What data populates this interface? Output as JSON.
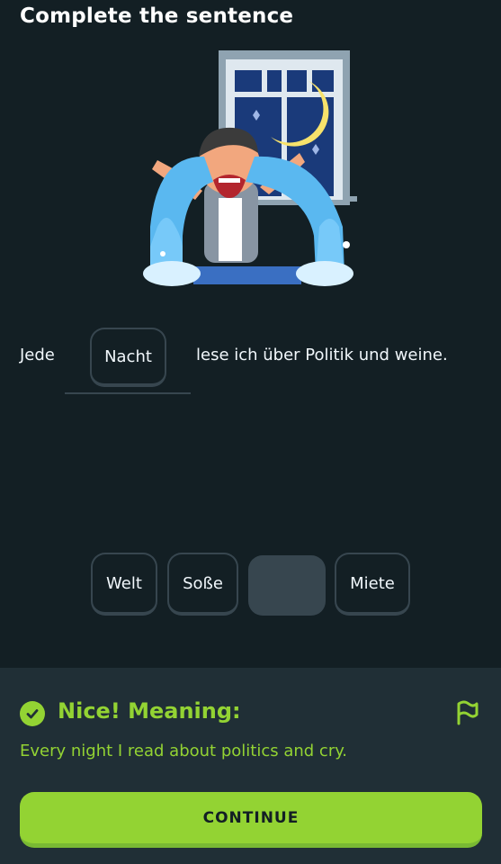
{
  "header": {
    "title": "Complete the sentence"
  },
  "sentence": {
    "before": "Jede",
    "answer": "Nacht",
    "after": "lese ich über Politik und weine."
  },
  "word_bank": {
    "options": [
      "Welt",
      "Soße",
      "",
      "Miete"
    ]
  },
  "feedback": {
    "heading": "Nice! Meaning:",
    "meaning": "Every night I read about politics and cry.",
    "continue_label": "CONTINUE",
    "icons": [
      "check-icon",
      "flag-icon"
    ]
  },
  "colors": {
    "background": "#131f24",
    "feedback_panel": "#202f36",
    "accent_green": "#93d333",
    "chip_border": "#37464f"
  }
}
